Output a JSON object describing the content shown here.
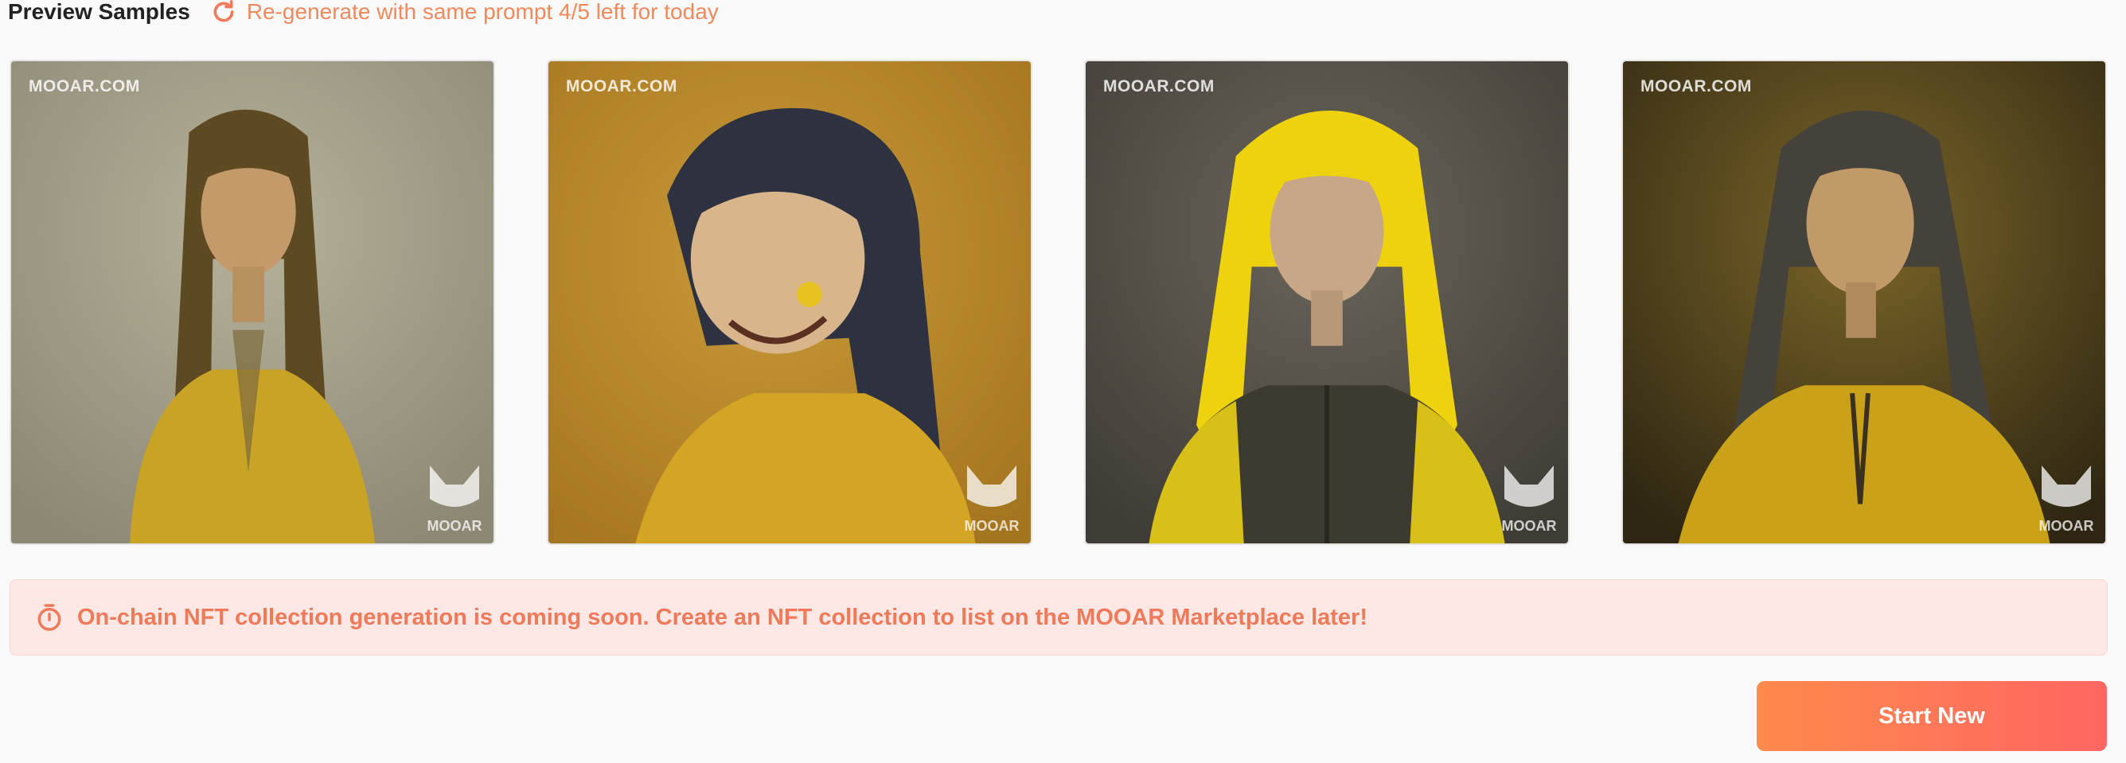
{
  "header": {
    "title": "Preview Samples",
    "regenerate_label": "Re-generate with same prompt 4/5 left for today",
    "regenerate_icon": "refresh-icon"
  },
  "samples": [
    {
      "watermark": "MOOAR.COM",
      "logo_text": "MOOAR",
      "hair_color": "#5d4a22",
      "bg_color": "#9a9682",
      "shirt_color": "#c9a325"
    },
    {
      "watermark": "MOOAR.COM",
      "logo_text": "MOOAR",
      "hair_color": "#2e3140",
      "bg_color": "#b8862a",
      "shirt_color": "#d4a424"
    },
    {
      "watermark": "MOOAR.COM",
      "logo_text": "MOOAR",
      "hair_color": "#efd20e",
      "bg_color": "#58544c",
      "shirt_color": "#3d3a30"
    },
    {
      "watermark": "MOOAR.COM",
      "logo_text": "MOOAR",
      "hair_color": "#45423c",
      "bg_color": "#4a3e1e",
      "shirt_color": "#c9a21a"
    }
  ],
  "notice": {
    "icon": "timer-icon",
    "text": "On-chain NFT collection generation is coming soon. Create an NFT collection to list on the MOOAR Marketplace later!"
  },
  "actions": {
    "start_new_label": "Start New"
  },
  "colors": {
    "accent": "#f08a5d",
    "notice_bg": "#fde8e6",
    "button_start": "#ff8a4c",
    "button_end": "#ff6662"
  }
}
